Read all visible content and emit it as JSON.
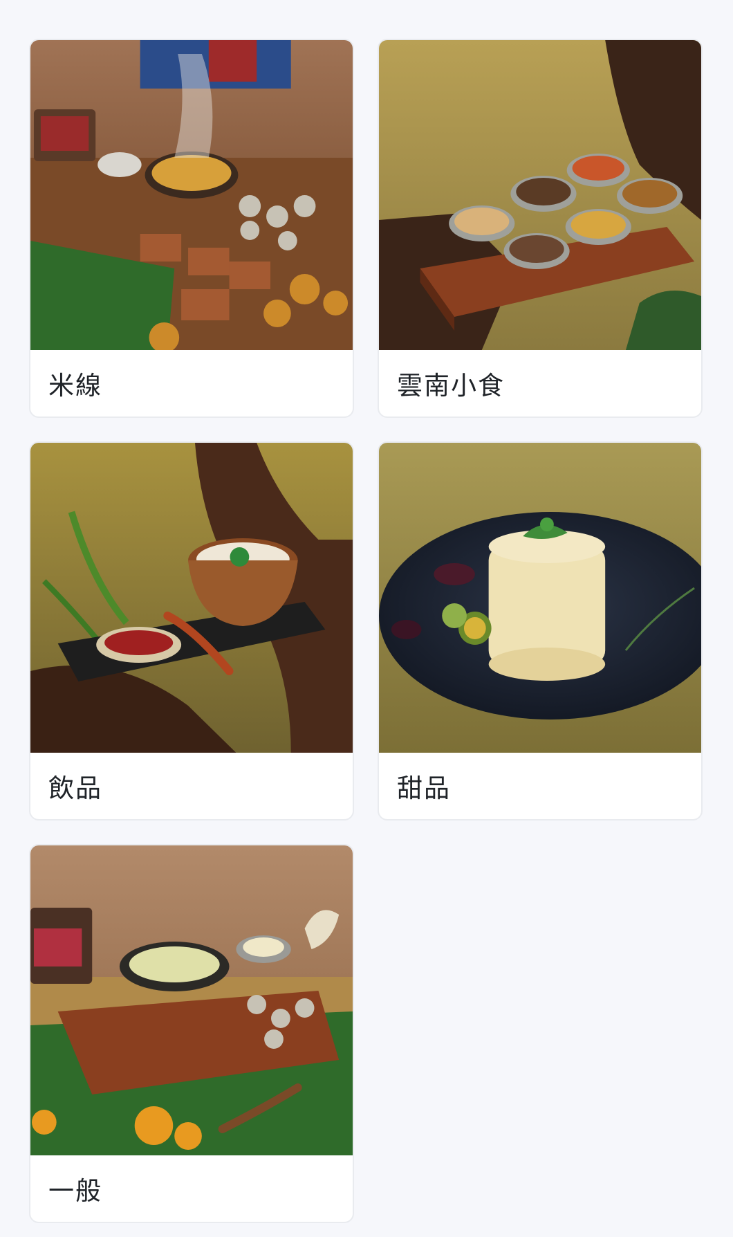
{
  "categories": [
    {
      "label": "米線",
      "image": "rice-noodle-feast-photo"
    },
    {
      "label": "雲南小食",
      "image": "yunnan-snacks-bowls-photo"
    },
    {
      "label": "飲品",
      "image": "drinks-bowl-photo"
    },
    {
      "label": "甜品",
      "image": "dessert-plate-photo"
    },
    {
      "label": "一般",
      "image": "general-feast-photo"
    }
  ],
  "colors": {
    "background": "#f6f7fb",
    "card": "#ffffff",
    "text": "#1f2328"
  }
}
